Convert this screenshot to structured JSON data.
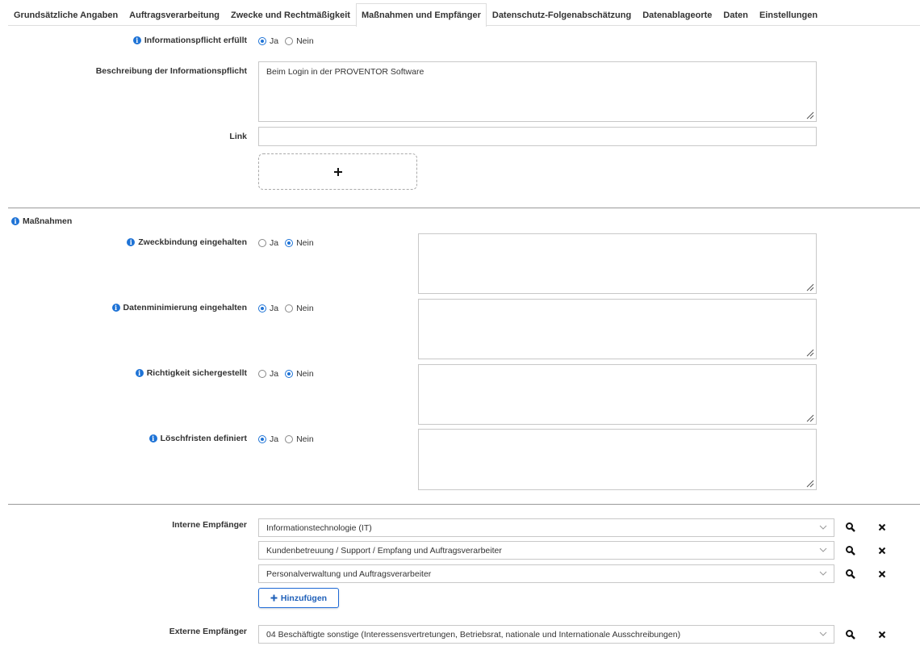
{
  "tabs": [
    {
      "label": "Grundsätzliche Angaben",
      "active": false
    },
    {
      "label": "Auftragsverarbeitung",
      "active": false
    },
    {
      "label": "Zwecke und Rechtmäßigkeit",
      "active": false
    },
    {
      "label": "Maßnahmen und Empfänger",
      "active": true
    },
    {
      "label": "Datenschutz-Folgenabschätzung",
      "active": false
    },
    {
      "label": "Datenablageorte",
      "active": false
    },
    {
      "label": "Daten",
      "active": false
    },
    {
      "label": "Einstellungen",
      "active": false
    }
  ],
  "info": {
    "informationspflicht_label": "Informationspflicht erfüllt",
    "informationspflicht_value": "Ja",
    "beschreibung_label": "Beschreibung der Informationspflicht",
    "beschreibung_value": "Beim Login in der PROVENTOR Software",
    "link_label": "Link",
    "link_value": "",
    "upload_icon": "plus-icon"
  },
  "radio_labels": {
    "yes": "Ja",
    "no": "Nein"
  },
  "massnahmen": {
    "title": "Maßnahmen",
    "items": [
      {
        "label": "Zweckbindung eingehalten",
        "value": "Nein",
        "comment": ""
      },
      {
        "label": "Datenminimierung eingehalten",
        "value": "Ja",
        "comment": ""
      },
      {
        "label": "Richtigkeit sichergestellt",
        "value": "Nein",
        "comment": ""
      },
      {
        "label": "Löschfristen definiert",
        "value": "Ja",
        "comment": ""
      }
    ]
  },
  "empfaenger": {
    "intern_label": "Interne Empfänger",
    "intern": [
      "Informationstechnologie (IT)",
      "Kundenbetreuung / Support / Empfang und Auftragsverarbeiter",
      "Personalverwaltung und Auftragsverarbeiter"
    ],
    "add_label": "Hinzufügen",
    "extern_label": "Externe Empfänger",
    "extern": [
      "04 Beschäftigte sonstige (Interessensvertretungen, Betriebsrat, nationale und Internationale Ausschreibungen)"
    ]
  },
  "colors": {
    "accent": "#1e73d6"
  }
}
